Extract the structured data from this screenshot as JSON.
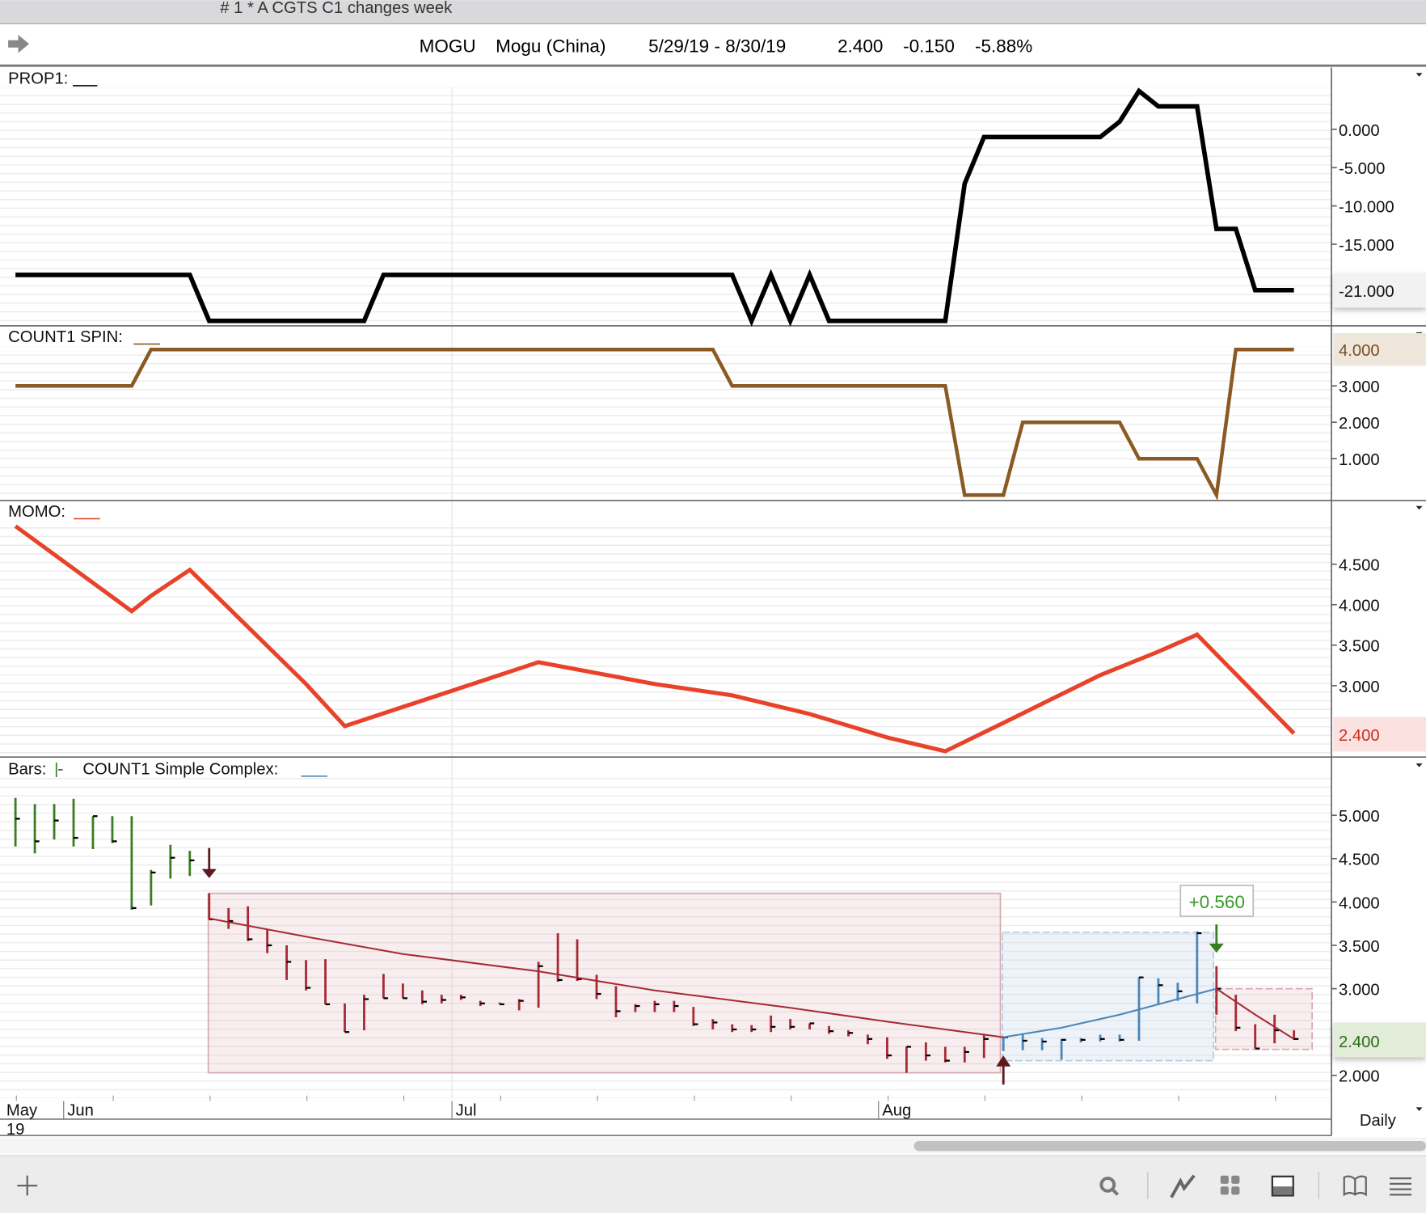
{
  "window": {
    "title": "# 1 * A CGTS  C1 changes week"
  },
  "header": {
    "symbol": "MOGU",
    "name": "Mogu (China)",
    "range": "5/29/19 - 8/30/19",
    "last": "2.400",
    "change": "-0.150",
    "pct": "-5.88%"
  },
  "panels": {
    "prop1": {
      "label": "PROP1:",
      "ticks": [
        "0.000",
        "-5.000",
        "-10.000",
        "-15.000"
      ],
      "tick_values": [
        0,
        -5,
        -10,
        -15
      ],
      "current": "-21.000",
      "current_value": -21
    },
    "spin": {
      "label": "COUNT1 SPIN:",
      "ticks": [
        "3.000",
        "2.000",
        "1.000"
      ],
      "tick_values": [
        3,
        2,
        1
      ],
      "current": "4.000",
      "current_value": 4
    },
    "momo": {
      "label": "MOMO:",
      "ticks": [
        "4.500",
        "4.000",
        "3.500",
        "3.000"
      ],
      "tick_values": [
        4.5,
        4,
        3.5,
        3
      ],
      "current": "2.400",
      "current_value": 2.4
    },
    "bars": {
      "label": "Bars:",
      "label2": "COUNT1 Simple Complex:",
      "ticks": [
        "5.000",
        "4.500",
        "4.000",
        "3.500",
        "3.000",
        "2.000"
      ],
      "tick_values": [
        5,
        4.5,
        4,
        3.5,
        3,
        2
      ],
      "current": "2.400",
      "current_value": 2.4,
      "annotation": "+0.560"
    }
  },
  "xaxis": {
    "labels": [
      "May",
      "Jun",
      "Jul",
      "Aug"
    ],
    "year": "19",
    "period": "Daily"
  },
  "colors": {
    "prop1": "#000000",
    "spin": "#8b5a24",
    "momo": "#e8432a",
    "up": "#3a7d22",
    "down": "#a52a35",
    "blue": "#4a86b8"
  },
  "chart_data": {
    "type": "line",
    "x_unit": "trading day index (0 = 5/29/19, 66 = 8/30/19)",
    "prop1": [
      [
        0,
        -19
      ],
      [
        9,
        -19
      ],
      [
        10,
        -25
      ],
      [
        18,
        -25
      ],
      [
        19,
        -19
      ],
      [
        37,
        -19
      ],
      [
        38,
        -25
      ],
      [
        39,
        -19
      ],
      [
        40,
        -25
      ],
      [
        41,
        -19
      ],
      [
        42,
        -25
      ],
      [
        48,
        -25
      ],
      [
        49,
        -7.1
      ],
      [
        50,
        -1
      ],
      [
        56,
        -1
      ],
      [
        57,
        1
      ],
      [
        58,
        5
      ],
      [
        59,
        3
      ],
      [
        61,
        3
      ],
      [
        62,
        -13
      ],
      [
        63,
        -13
      ],
      [
        64,
        -21
      ],
      [
        66,
        -21
      ]
    ],
    "spin": [
      [
        0,
        3
      ],
      [
        6,
        3
      ],
      [
        7,
        4
      ],
      [
        36,
        4
      ],
      [
        37,
        3
      ],
      [
        48,
        3
      ],
      [
        49,
        0
      ],
      [
        51,
        0
      ],
      [
        52,
        2
      ],
      [
        57,
        2
      ],
      [
        58,
        1
      ],
      [
        61,
        1
      ],
      [
        62,
        0
      ],
      [
        63,
        4
      ],
      [
        66,
        4
      ]
    ],
    "momo": [
      [
        0,
        4.97
      ],
      [
        6,
        3.92
      ],
      [
        7,
        4.11
      ],
      [
        9,
        4.43
      ],
      [
        15,
        3.02
      ],
      [
        17,
        2.5
      ],
      [
        27,
        3.29
      ],
      [
        29,
        3.2
      ],
      [
        33,
        3.02
      ],
      [
        37,
        2.88
      ],
      [
        41,
        2.65
      ],
      [
        45,
        2.36
      ],
      [
        48,
        2.19
      ],
      [
        51,
        2.54
      ],
      [
        56,
        3.13
      ],
      [
        59,
        3.42
      ],
      [
        61,
        3.63
      ],
      [
        66,
        2.41
      ]
    ],
    "bars": [
      [
        5.2,
        4.64,
        4.96
      ],
      [
        5.13,
        4.56,
        4.7
      ],
      [
        5.13,
        4.72,
        4.94
      ],
      [
        5.19,
        4.64,
        4.74
      ],
      [
        4.99,
        4.61,
        4.99
      ],
      [
        4.99,
        4.68,
        4.7
      ],
      [
        4.99,
        3.91,
        3.93
      ],
      [
        4.37,
        3.96,
        4.34
      ],
      [
        4.66,
        4.27,
        4.51
      ],
      [
        4.59,
        4.3,
        4.48
      ],
      [
        4.1,
        3.8,
        3.8
      ],
      [
        3.93,
        3.69,
        3.78
      ],
      [
        3.95,
        3.55,
        3.57
      ],
      [
        3.69,
        3.41,
        3.5
      ],
      [
        3.5,
        3.1,
        3.31
      ],
      [
        3.33,
        2.98,
        3.01
      ],
      [
        3.34,
        2.82,
        2.82
      ],
      [
        2.83,
        2.5,
        2.5
      ],
      [
        2.93,
        2.52,
        2.88
      ],
      [
        3.17,
        2.89,
        2.89
      ],
      [
        3.06,
        2.89,
        2.89
      ],
      [
        2.98,
        2.82,
        2.85
      ],
      [
        2.93,
        2.83,
        2.87
      ],
      [
        2.93,
        2.87,
        2.9
      ],
      [
        2.86,
        2.8,
        2.83
      ],
      [
        2.84,
        2.82,
        2.82
      ],
      [
        2.88,
        2.75,
        2.86
      ],
      [
        3.31,
        2.78,
        3.26
      ],
      [
        3.64,
        3.08,
        3.1
      ],
      [
        3.57,
        3.09,
        3.11
      ],
      [
        3.16,
        2.88,
        2.94
      ],
      [
        3.03,
        2.67,
        2.74
      ],
      [
        2.82,
        2.73,
        2.8
      ],
      [
        2.86,
        2.73,
        2.82
      ],
      [
        2.86,
        2.73,
        2.8
      ],
      [
        2.79,
        2.57,
        2.59
      ],
      [
        2.65,
        2.53,
        2.61
      ],
      [
        2.59,
        2.5,
        2.53
      ],
      [
        2.58,
        2.5,
        2.53
      ],
      [
        2.69,
        2.5,
        2.56
      ],
      [
        2.65,
        2.53,
        2.56
      ],
      [
        2.6,
        2.53,
        2.6
      ],
      [
        2.57,
        2.48,
        2.51
      ],
      [
        2.52,
        2.45,
        2.49
      ],
      [
        2.47,
        2.36,
        2.42
      ],
      [
        2.44,
        2.19,
        2.23
      ],
      [
        2.33,
        2.03,
        2.33
      ],
      [
        2.38,
        2.17,
        2.23
      ],
      [
        2.33,
        2.15,
        2.17
      ],
      [
        2.33,
        2.15,
        2.27
      ],
      [
        2.48,
        2.2,
        2.42
      ],
      [
        2.45,
        2.28,
        2.44
      ],
      [
        2.48,
        2.29,
        2.4
      ],
      [
        2.43,
        2.29,
        2.39
      ],
      [
        2.42,
        2.18,
        2.41
      ],
      [
        2.43,
        2.38,
        2.41
      ],
      [
        2.47,
        2.39,
        2.42
      ],
      [
        2.47,
        2.39,
        2.41
      ],
      [
        3.13,
        2.4,
        3.13
      ],
      [
        3.12,
        2.81,
        3.04
      ],
      [
        3.07,
        2.86,
        2.97
      ],
      [
        3.66,
        2.83,
        3.64
      ],
      [
        3.26,
        2.7,
        3.0
      ],
      [
        2.93,
        2.51,
        2.55
      ],
      [
        2.59,
        2.31,
        2.31
      ],
      [
        2.7,
        2.37,
        2.52
      ],
      [
        2.52,
        2.41,
        2.42
      ]
    ],
    "segments": [
      {
        "from": 10,
        "to": 50,
        "color": "down",
        "box": [
          4.1,
          2.03
        ],
        "trend": [
          [
            10,
            3.81
          ],
          [
            15,
            3.6
          ],
          [
            20,
            3.4
          ],
          [
            27,
            3.2
          ],
          [
            33,
            2.98
          ],
          [
            40,
            2.78
          ],
          [
            45,
            2.62
          ],
          [
            51,
            2.44
          ]
        ]
      },
      {
        "from": 51,
        "to": 61,
        "color": "blue",
        "box": [
          3.65,
          2.17
        ],
        "trend": [
          [
            51,
            2.44
          ],
          [
            54,
            2.55
          ],
          [
            57,
            2.7
          ],
          [
            59,
            2.82
          ],
          [
            62,
            3.0
          ]
        ]
      },
      {
        "from": 62,
        "to": 66,
        "color": "down",
        "box": [
          3.0,
          2.3
        ],
        "trend": [
          [
            62,
            3.0
          ],
          [
            64,
            2.7
          ],
          [
            66,
            2.42
          ]
        ]
      }
    ],
    "signals": [
      {
        "index": 10,
        "dir": "down",
        "color": "#5a1a1e"
      },
      {
        "index": 51,
        "dir": "up",
        "color": "#5a1a1e"
      },
      {
        "index": 62,
        "dir": "down",
        "color": "#3a7d22"
      }
    ]
  }
}
